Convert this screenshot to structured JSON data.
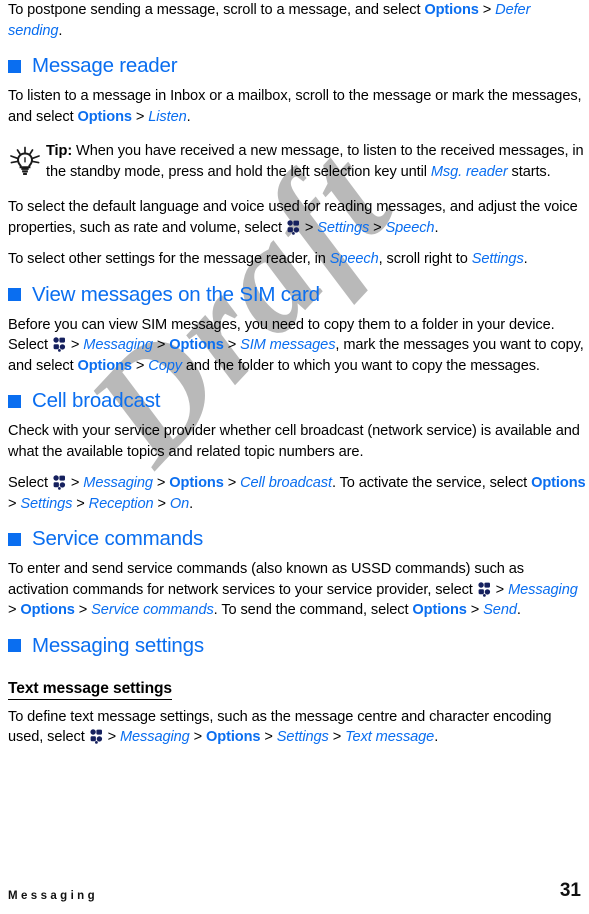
{
  "document": {
    "chapter_footer": "Messaging",
    "page_number": "31",
    "watermark_text": "Draft",
    "accent_color": "#0a6ef0",
    "watermark_color": "#b9b9b9",
    "text_color": "#000000"
  },
  "icons": {
    "menu_key": "navi-menu-key-icon",
    "tip_bulb": "lightbulb-icon",
    "section_bullet": "blue-square-bullet-icon"
  },
  "intro_paragraph": {
    "t1": "To postpone sending a message, scroll to a message, and select ",
    "options": "Options",
    "sep1": " > ",
    "defer_sending": "Defer sending",
    "t2": "."
  },
  "sections": [
    {
      "id": "message-reader",
      "heading": "Message reader",
      "paragraphs": [
        {
          "id": "listen-paragraph",
          "t1": "To listen to a message in Inbox or a mailbox, scroll to the message or mark the messages, and select ",
          "options": "Options",
          "sep1": " > ",
          "listen": "Listen",
          "t2": "."
        }
      ],
      "tip": {
        "label": "Tip:",
        "t1": " When you have received a new message, to listen to the received messages, in the standby mode, press and hold the left selection key until ",
        "msg_reader": "Msg. reader",
        "t2": " starts."
      },
      "paragraphs2": [
        {
          "id": "speech-settings-paragraph",
          "t1": "To select the default language and voice used for reading messages, and adjust the voice properties, such as rate and volume, select ",
          "sep1": " > ",
          "settings": "Settings",
          "sep2": " > ",
          "speech": "Speech",
          "t2": "."
        },
        {
          "id": "reader-other-settings-paragraph",
          "t1": "To select other settings for the message reader, in ",
          "speech": "Speech",
          "t2": ", scroll right to ",
          "settings": "Settings",
          "t3": "."
        }
      ]
    },
    {
      "id": "view-messages-sim-card",
      "heading": "View messages on the SIM card",
      "paragraphs": [
        {
          "id": "sim-copy-paragraph",
          "t1": "Before you can view SIM messages, you need to copy them to a folder in your device. Select ",
          "sep1": " > ",
          "messaging": "Messaging",
          "sep2": " > ",
          "options": "Options",
          "sep3": " > ",
          "sim_messages": "SIM messages",
          "t2": ", mark the messages you want to copy, and select ",
          "options2": "Options",
          "sep4": " > ",
          "copy": "Copy",
          "t3": " and the folder to which you want to copy the messages."
        }
      ]
    },
    {
      "id": "cell-broadcast",
      "heading": "Cell broadcast",
      "paragraphs": [
        {
          "id": "cell-broadcast-check-paragraph",
          "t1": "Check with your service provider whether cell broadcast (network service) is available and what the available topics and related topic numbers are."
        },
        {
          "id": "cell-broadcast-select-paragraph",
          "t1": "Select ",
          "sep1": " > ",
          "messaging": "Messaging",
          "sep2": " > ",
          "options": "Options",
          "sep3": " > ",
          "cell_broadcast": "Cell broadcast",
          "t2": ". To activate the service, select ",
          "options2": "Options",
          "sep4": " > ",
          "settings": "Settings",
          "sep5": " > ",
          "reception": "Reception",
          "sep6": " > ",
          "on": "On",
          "t3": "."
        }
      ]
    },
    {
      "id": "service-commands",
      "heading": "Service commands",
      "paragraphs": [
        {
          "id": "service-commands-paragraph",
          "t1": "To enter and send service commands (also known as USSD commands) such as activation commands for network services to your service provider, select ",
          "sep1": " > ",
          "messaging": "Messaging",
          "sep2": " > ",
          "options": "Options",
          "sep3": " > ",
          "service_commands": "Service commands",
          "t2": ". To send the command, select ",
          "options2": "Options",
          "sep4": " > ",
          "send": "Send",
          "t3": "."
        }
      ]
    },
    {
      "id": "messaging-settings",
      "heading": "Messaging settings",
      "subheading": "Text message settings",
      "paragraphs": [
        {
          "id": "text-message-settings-paragraph",
          "t1": "To define text message settings, such as the message centre and character encoding used, select ",
          "sep1": " > ",
          "messaging": "Messaging",
          "sep2": " > ",
          "options": "Options",
          "sep3": " > ",
          "settings": "Settings",
          "sep4": " > ",
          "text_message": "Text message",
          "t2": "."
        }
      ]
    }
  ]
}
